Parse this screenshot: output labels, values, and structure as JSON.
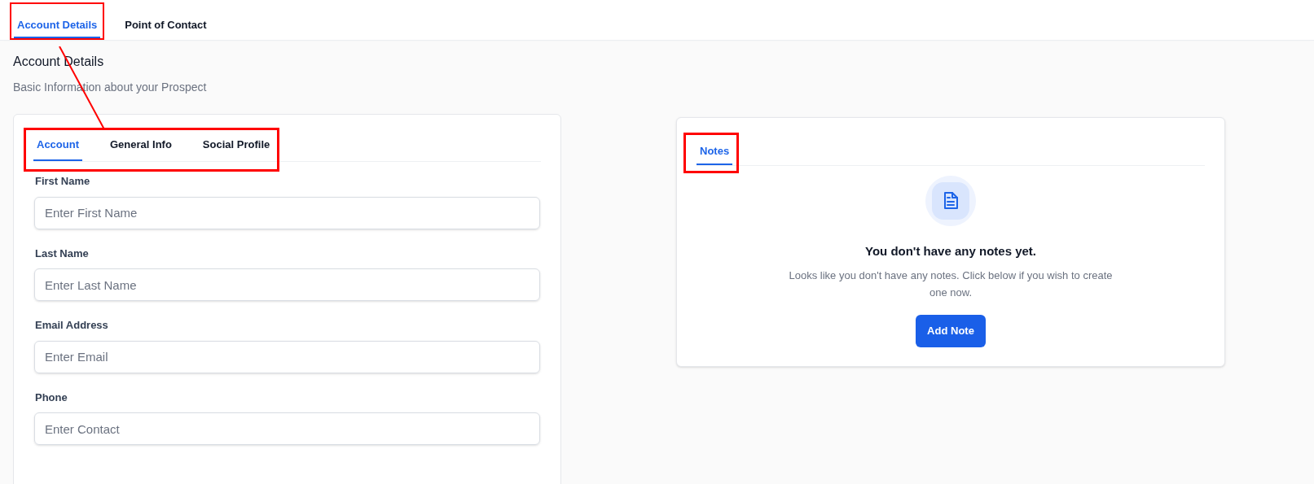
{
  "top_tabs": [
    {
      "label": "Account Details",
      "selected": true
    },
    {
      "label": "Point of Contact",
      "selected": false
    }
  ],
  "section": {
    "title": "Account Details",
    "subtitle": "Basic Information about your Prospect"
  },
  "account_card": {
    "tabs": [
      {
        "label": "Account",
        "selected": true
      },
      {
        "label": "General Info",
        "selected": false
      },
      {
        "label": "Social Profile",
        "selected": false
      }
    ],
    "fields": [
      {
        "label": "First Name",
        "placeholder": "Enter First Name"
      },
      {
        "label": "Last Name",
        "placeholder": "Enter Last Name"
      },
      {
        "label": "Email Address",
        "placeholder": "Enter Email"
      },
      {
        "label": "Phone",
        "placeholder": "Enter Contact"
      }
    ]
  },
  "notes_card": {
    "tabs": [
      {
        "label": "Notes",
        "selected": true
      }
    ],
    "empty_title": "You don't have any notes yet.",
    "empty_text": "Looks like you don't have any notes. Click below if you wish to create one now.",
    "button": "Add Note"
  }
}
